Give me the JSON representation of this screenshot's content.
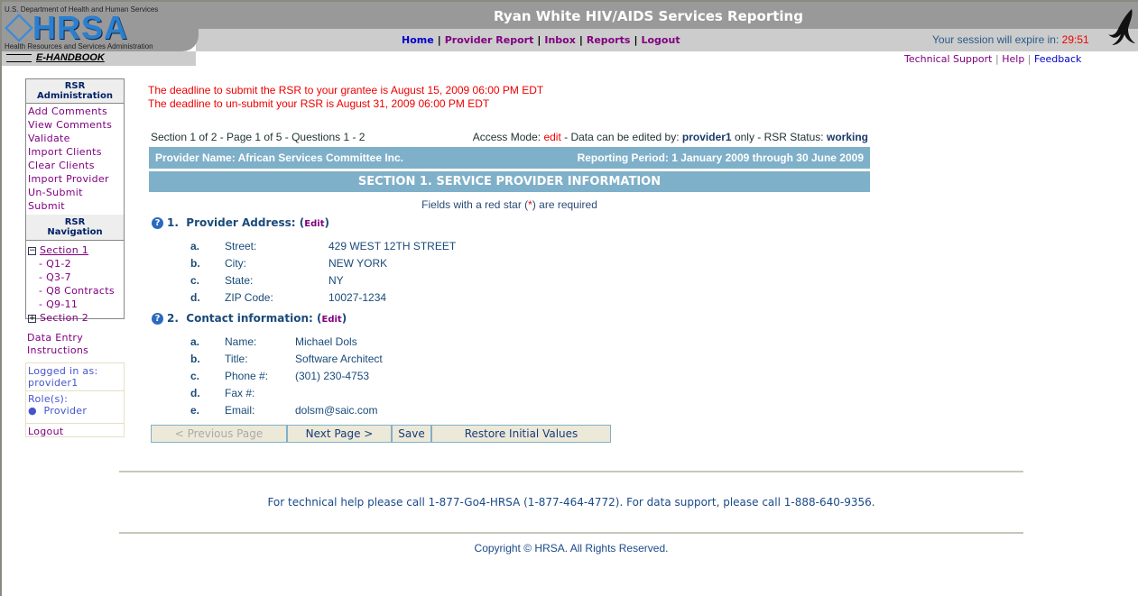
{
  "header": {
    "dept": "U.S. Department of Health and Human Services",
    "logo": "HRSA",
    "agency": "Health Resources and Services Administration",
    "handbook": "E-HANDBOOK",
    "title": "Ryan White HIV/AIDS Services Reporting",
    "nav": [
      "Home",
      "Provider Report",
      "Inbox",
      "Reports",
      "Logout"
    ],
    "session_label": "Your session will expire in:",
    "session_time": "29:51",
    "links": [
      "Technical Support",
      "Help",
      "Feedback"
    ]
  },
  "sidebar": {
    "admin_title": "RSR Administration",
    "admin_items": [
      "Add Comments",
      "View Comments",
      "Validate",
      "Import Clients",
      "Clear Clients",
      "Import Provider",
      "Un-Submit",
      "Submit"
    ],
    "nav_title": "RSR Navigation",
    "section1": "Section 1",
    "section1_items": [
      "- Q1-2",
      "- Q3-7",
      "- Q8 Contracts",
      "- Q9-11"
    ],
    "section2": "Section 2",
    "data_entry": "Data Entry Instructions",
    "logged_in_label": "Logged in as:",
    "user": "provider1",
    "roles_label": "Role(s):",
    "role": "Provider",
    "logout": "Logout"
  },
  "main": {
    "deadline1": "The deadline to submit the RSR to your grantee is August 15, 2009 06:00 PM EDT",
    "deadline2": "The deadline to un-submit your RSR is August 31, 2009 06:00 PM EDT",
    "page_info": "Section 1 of 2 - Page 1 of 5 - Questions 1 - 2",
    "access": {
      "label": "Access Mode:",
      "mode": "edit",
      "mid": "- Data can be edited by:",
      "user": "provider1",
      "only": "only - RSR Status:",
      "status": "working"
    },
    "provider_name": "Provider Name: African Services Committee Inc.",
    "reporting_period": "Reporting Period: 1 January 2009 through 30 June 2009",
    "section_title": "SECTION 1. SERVICE PROVIDER INFORMATION",
    "required_note_pre": "Fields with a red star (",
    "required_star": "*",
    "required_note_post": ") are required",
    "q1": {
      "num": "1.",
      "title": "Provider Address:",
      "edit": "Edit",
      "rows": [
        {
          "l": "a.",
          "n": "Street:",
          "v": "429 WEST 12TH STREET"
        },
        {
          "l": "b.",
          "n": "City:",
          "v": "NEW YORK"
        },
        {
          "l": "c.",
          "n": "State:",
          "v": "NY"
        },
        {
          "l": "d.",
          "n": "ZIP Code:",
          "v": "10027-1234"
        }
      ]
    },
    "q2": {
      "num": "2.",
      "title": "Contact information:",
      "edit": "Edit",
      "rows": [
        {
          "l": "a.",
          "n": "Name:",
          "v": "Michael Dols"
        },
        {
          "l": "b.",
          "n": "Title:",
          "v": "Software Architect"
        },
        {
          "l": "c.",
          "n": "Phone #:",
          "v": "(301) 230-4753"
        },
        {
          "l": "d.",
          "n": "Fax #:",
          "v": ""
        },
        {
          "l": "e.",
          "n": "Email:",
          "v": "dolsm@saic.com"
        }
      ]
    },
    "buttons": {
      "prev": "< Previous Page",
      "next": "Next Page >",
      "save": "Save",
      "restore": "Restore Initial Values"
    }
  },
  "footer": {
    "help": "For technical help please call 1-877-Go4-HRSA (1-877-464-4772). For data support, please call 1-888-640-9356.",
    "copyright": "Copyright © HRSA. All Rights Reserved."
  }
}
